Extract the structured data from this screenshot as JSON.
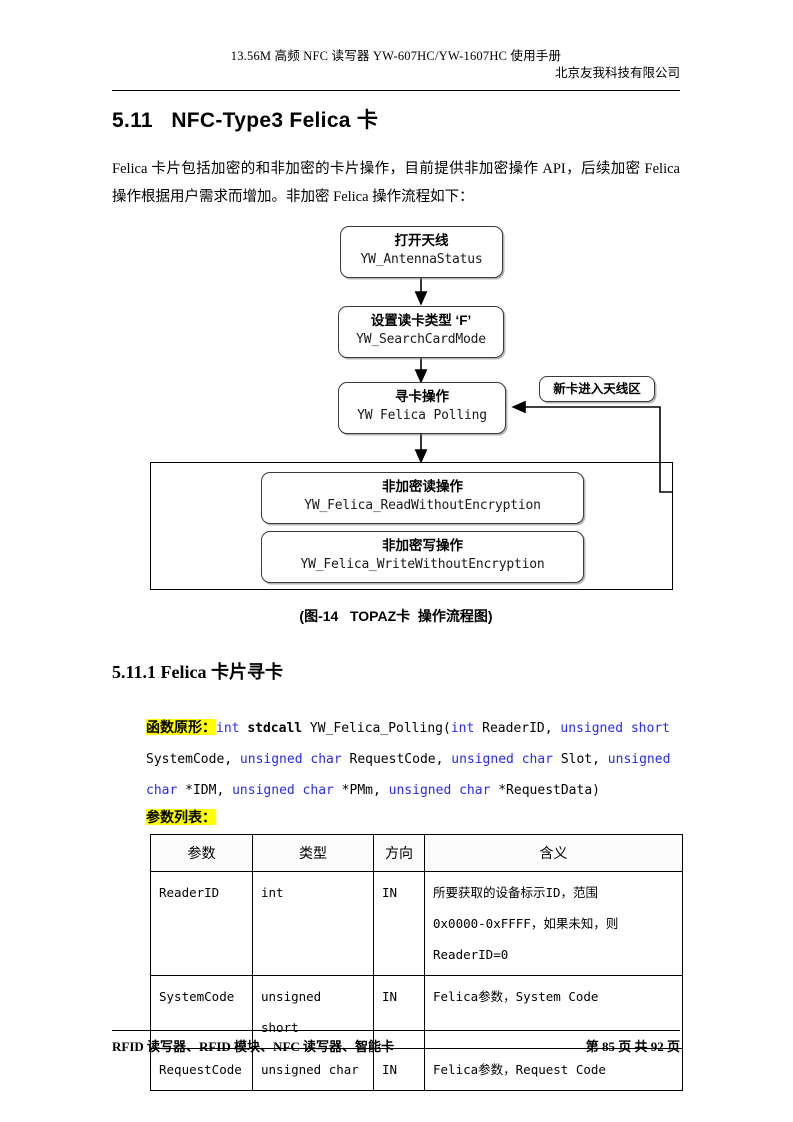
{
  "header": {
    "line1": "13.56M  高频 NFC 读写器 YW-607HC/YW-1607HC 使用手册",
    "line2": "北京友我科技有限公司"
  },
  "section": {
    "number": "5.11",
    "title": "5.11   NFC-Type3 Felica 卡",
    "intro": "Felica 卡片包括加密的和非加密的卡片操作，目前提供非加密操作 API，后续加密 Felica 操作根据用户需求而增加。非加密 Felica 操作流程如下："
  },
  "flowchart": {
    "caption": "(图-14   TOPAZ卡  操作流程图)",
    "nodes": [
      {
        "cn": "打开天线",
        "fn": "YW_AntennaStatus"
      },
      {
        "cn": "设置读卡类型 ‘F’",
        "fn": "YW_SearchCardMode"
      },
      {
        "cn": "寻卡操作",
        "fn": "YW Felica Polling"
      },
      {
        "cn": "非加密读操作",
        "fn": "YW_Felica_ReadWithoutEncryption"
      },
      {
        "cn": "非加密写操作",
        "fn": "YW_Felica_WriteWithoutEncryption"
      }
    ],
    "feedback_label": "新卡进入天线区"
  },
  "subsection": {
    "title": "5.11.1 Felica 卡片寻卡"
  },
  "prototype": {
    "label": "函数原形：",
    "tokens": [
      {
        "t": "int",
        "c": "kw"
      },
      {
        "t": " ",
        "c": "plain"
      },
      {
        "t": "stdcall",
        "c": "bold"
      },
      {
        "t": " YW_Felica_Polling(",
        "c": "plain"
      },
      {
        "t": "int",
        "c": "kw"
      },
      {
        "t": " ReaderID, ",
        "c": "plain"
      },
      {
        "t": "unsigned short",
        "c": "kw"
      },
      {
        "t": " SystemCode, ",
        "c": "plain"
      },
      {
        "t": "unsigned char",
        "c": "kw"
      },
      {
        "t": " RequestCode, ",
        "c": "plain"
      },
      {
        "t": "unsigned char",
        "c": "kw"
      },
      {
        "t": " Slot, ",
        "c": "plain"
      },
      {
        "t": "unsigned char",
        "c": "kw"
      },
      {
        "t": " *IDM, ",
        "c": "plain"
      },
      {
        "t": "unsigned char",
        "c": "kw"
      },
      {
        "t": " *PMm, ",
        "c": "plain"
      },
      {
        "t": "unsigned char",
        "c": "kw"
      },
      {
        "t": " *RequestData)",
        "c": "plain"
      }
    ]
  },
  "params": {
    "label": "参数列表：",
    "columns": [
      "参数",
      "类型",
      "方向",
      "含义"
    ],
    "rows": [
      {
        "name": "ReaderID",
        "type": "int",
        "dir": "IN",
        "meaning": "所要获取的设备标示ID，范围\n0x0000-0xFFFF，如果未知，则\nReaderID=0"
      },
      {
        "name": "SystemCode",
        "type": "unsigned short",
        "dir": "IN",
        "meaning": "Felica参数，System Code"
      },
      {
        "name": "RequestCode",
        "type": "unsigned char",
        "dir": "IN",
        "meaning": "Felica参数，Request Code"
      }
    ]
  },
  "footer": {
    "left": "RFID 读写器、RFID 模块、NFC 读写器、智能卡",
    "right": "第 85 页 共 92 页"
  },
  "colors": {
    "keyword": "#2a2aee",
    "highlight": "#ffff00",
    "text": "#000000"
  }
}
